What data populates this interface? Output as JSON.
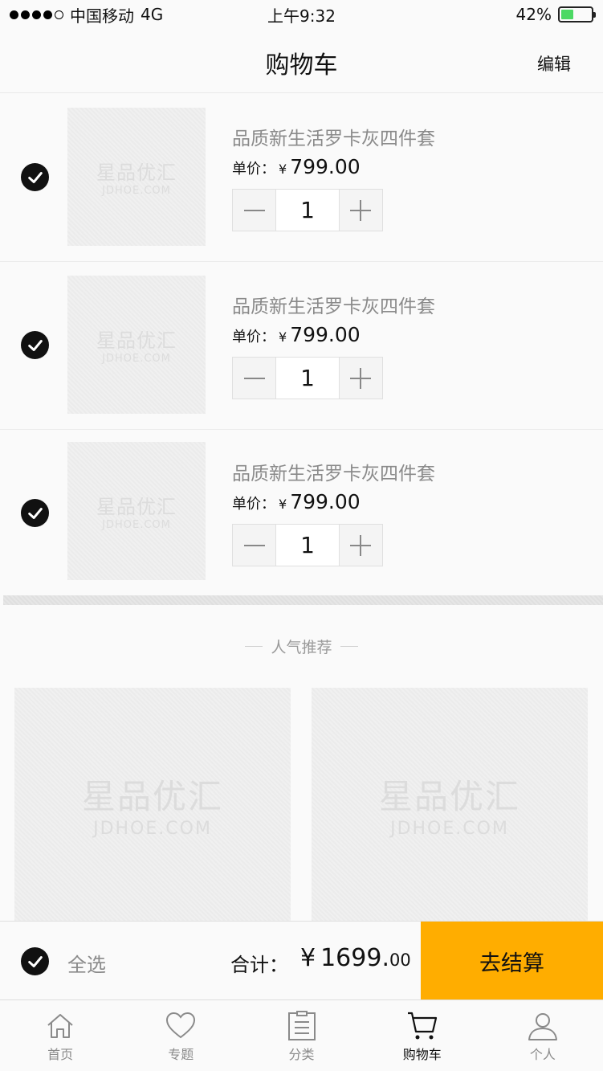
{
  "status_bar": {
    "carrier": "中国移动",
    "network": "4G",
    "time": "上午9:32",
    "battery_percent": "42%",
    "battery_level": 0.42,
    "signal_bars_filled": 4,
    "signal_bars_total": 5
  },
  "nav": {
    "title": "购物车",
    "edit_label": "编辑"
  },
  "cart_items": [
    {
      "title": "品质新生活罗卡灰四件套",
      "price_label": "单价：",
      "currency": "¥",
      "price": "799.00",
      "quantity": "1",
      "checked": true,
      "image_watermark_line1": "星品优汇",
      "image_watermark_line2": "JDHOE.COM"
    },
    {
      "title": "品质新生活罗卡灰四件套",
      "price_label": "单价：",
      "currency": "¥",
      "price": "799.00",
      "quantity": "1",
      "checked": true,
      "image_watermark_line1": "星品优汇",
      "image_watermark_line2": "JDHOE.COM"
    },
    {
      "title": "品质新生活罗卡灰四件套",
      "price_label": "单价：",
      "currency": "¥",
      "price": "799.00",
      "quantity": "1",
      "checked": true,
      "image_watermark_line1": "星品优汇",
      "image_watermark_line2": "JDHOE.COM"
    }
  ],
  "recommend": {
    "title": "人气推荐",
    "cards": [
      {
        "watermark_line1": "星品优汇",
        "watermark_line2": "JDHOE.COM"
      },
      {
        "watermark_line1": "星品优汇",
        "watermark_line2": "JDHOE.COM"
      }
    ]
  },
  "checkout": {
    "select_all_label": "全选",
    "total_label": "合计：",
    "total_currency": "¥",
    "total_integer": "1699.",
    "total_decimal": "00",
    "button_label": "去结算"
  },
  "tabs": [
    {
      "label": "首页",
      "icon": "home-icon",
      "active": false
    },
    {
      "label": "专题",
      "icon": "heart-icon",
      "active": false
    },
    {
      "label": "分类",
      "icon": "list-icon",
      "active": false
    },
    {
      "label": "购物车",
      "icon": "cart-icon",
      "active": true
    },
    {
      "label": "个人",
      "icon": "user-icon",
      "active": false
    }
  ],
  "colors": {
    "accent": "#ffad00",
    "battery": "#4cd964",
    "check": "#111111",
    "muted_text": "#8a8a8a"
  }
}
